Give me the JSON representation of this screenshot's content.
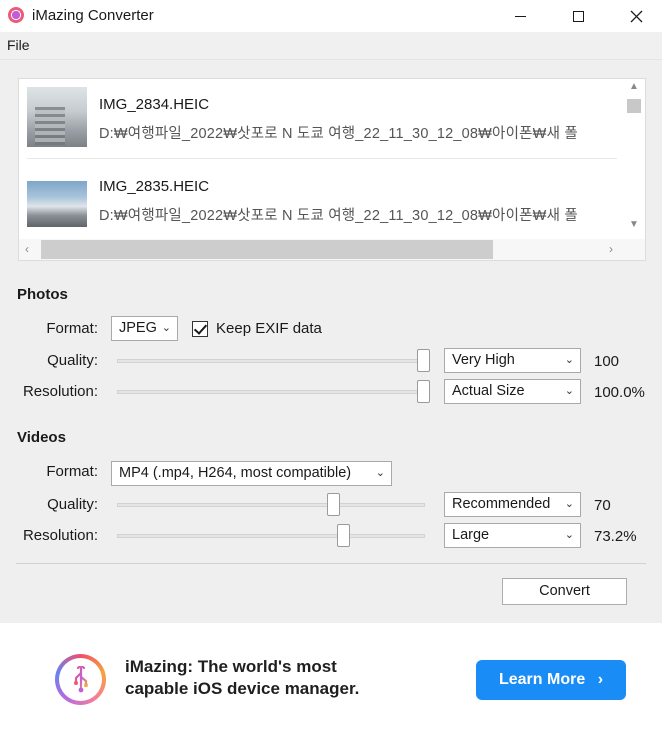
{
  "window": {
    "title": "iMazing Converter",
    "minimize_icon": "minimize-icon",
    "maximize_icon": "maximize-icon",
    "close_icon": "close-icon"
  },
  "menubar": {
    "file": "File"
  },
  "files": [
    {
      "name": "IMG_2834.HEIC",
      "path": "D:₩여행파일_2022₩삿포로 N 도쿄 여행_22_11_30_12_08₩아이폰₩새 폴"
    },
    {
      "name": "IMG_2835.HEIC",
      "path": "D:₩여행파일_2022₩삿포로 N 도쿄 여행_22_11_30_12_08₩아이폰₩새 폴"
    }
  ],
  "photos": {
    "title": "Photos",
    "format_label": "Format:",
    "format_value": "JPEG",
    "keep_exif_label": "Keep EXIF data",
    "keep_exif_checked": true,
    "quality_label": "Quality:",
    "quality_preset": "Very High",
    "quality_value": "100",
    "quality_level": 1.0,
    "resolution_label": "Resolution:",
    "resolution_preset": "Actual Size",
    "resolution_value": "100.0%",
    "resolution_level": 1.0
  },
  "videos": {
    "title": "Videos",
    "format_label": "Format:",
    "format_value": "MP4 (.mp4, H264, most compatible)",
    "quality_label": "Quality:",
    "quality_preset": "Recommended",
    "quality_value": "70",
    "quality_level": 0.7,
    "resolution_label": "Resolution:",
    "resolution_preset": "Large",
    "resolution_value": "73.2%",
    "resolution_level": 0.732
  },
  "actions": {
    "convert": "Convert"
  },
  "ad": {
    "line1": "iMazing: The world's most",
    "line2": "capable iOS device manager.",
    "button": "Learn More",
    "button_color": "#1a8cf6"
  }
}
